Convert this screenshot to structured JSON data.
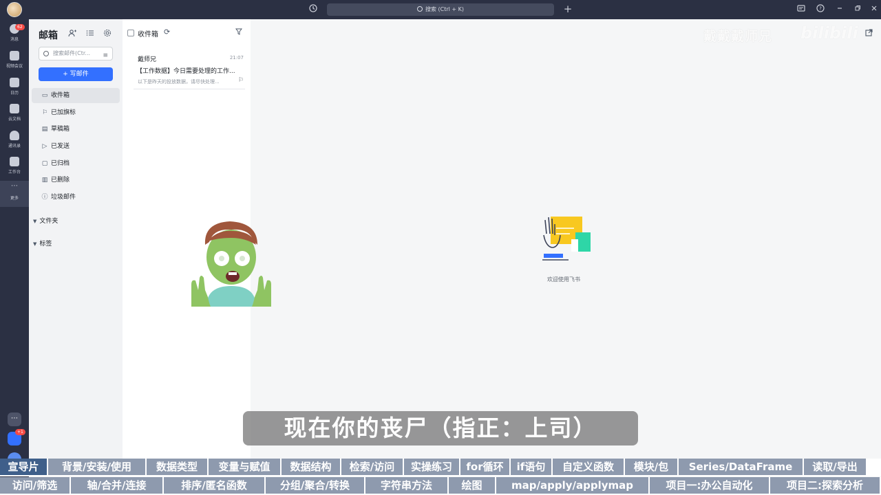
{
  "titlebar": {
    "search_placeholder": "搜索 (Ctrl + K)"
  },
  "rail": {
    "items": [
      {
        "label": "消息",
        "badge": "62",
        "icon": "chat-icon"
      },
      {
        "label": "视频会议",
        "icon": "video-icon"
      },
      {
        "label": "日历",
        "icon": "calendar-icon"
      },
      {
        "label": "云文档",
        "icon": "doc-icon"
      },
      {
        "label": "通讯录",
        "icon": "contacts-icon"
      },
      {
        "label": "工作台",
        "icon": "apps-icon"
      },
      {
        "label": "更多",
        "icon": "more-icon"
      }
    ],
    "bottom_badge": "+1"
  },
  "sidebar": {
    "title": "邮箱",
    "search_placeholder": "搜索邮件(Ctr...",
    "compose_label": "+ 写邮件",
    "folders": [
      {
        "label": "收件箱",
        "icon": "inbox-icon"
      },
      {
        "label": "已加旗标",
        "icon": "flag-icon"
      },
      {
        "label": "草稿箱",
        "icon": "draft-icon"
      },
      {
        "label": "已发送",
        "icon": "send-icon"
      },
      {
        "label": "已归档",
        "icon": "archive-icon"
      },
      {
        "label": "已删除",
        "icon": "trash-icon"
      },
      {
        "label": "垃圾邮件",
        "icon": "spam-icon"
      }
    ],
    "sections": [
      "文件夹",
      "标签"
    ]
  },
  "msglist": {
    "title": "收件箱",
    "items": [
      {
        "sender": "戴师兄",
        "time": "21:07",
        "subject": "【工作数据】今日需要处理的工作...",
        "preview": "以下是昨天的投放数据，请尽快处理..."
      }
    ]
  },
  "content": {
    "welcome": "欢迎使用飞书"
  },
  "watermark": {
    "text1": "戴戴戴师兄",
    "text2": "bilibili"
  },
  "subtitle": "现在你的丧尸（指正：上司）",
  "course_nav": {
    "row1": [
      "宣导片",
      "背景/安装/使用",
      "数据类型",
      "变量与赋值",
      "数据结构",
      "检索/访问",
      "实操练习",
      "for循环",
      "if语句",
      "自定义函数",
      "模块/包",
      "Series/DataFrame",
      "读取/导出"
    ],
    "row2": [
      "访问/筛选",
      "轴/合并/连接",
      "排序/匿名函数",
      "分组/聚合/转换",
      "字符串方法",
      "绘图",
      "map/apply/applymap",
      "项目一:办公自动化",
      "项目二:探索分析"
    ]
  },
  "colors": {
    "titlebar": "#2b3043",
    "accent": "#3370ff",
    "nav_cell": "#8e9aae",
    "nav_cell_highlight": "#3f5f8a"
  }
}
